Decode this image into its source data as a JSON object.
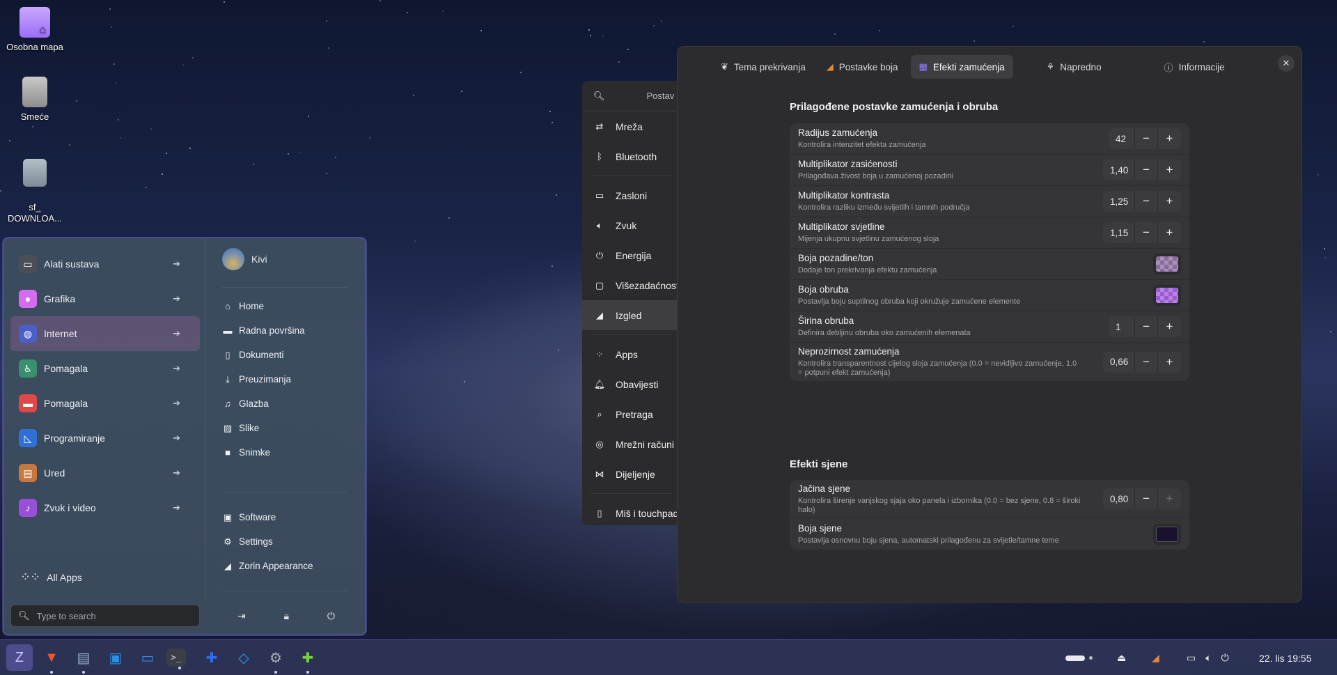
{
  "desktop": {
    "icons": [
      {
        "label": "Osobna mapa"
      },
      {
        "label": "Smeće"
      },
      {
        "label": "sf_\nDOWNLOA..."
      }
    ]
  },
  "start_menu": {
    "categories": [
      {
        "label": "Alati sustava",
        "icon": "monitor-icon",
        "color": "#4a4f57"
      },
      {
        "label": "Grafika",
        "icon": "palette-icon",
        "color": "#d46cf0"
      },
      {
        "label": "Internet",
        "icon": "globe-icon",
        "color": "#4b5fc8"
      },
      {
        "label": "Pomagala",
        "icon": "accessibility-icon",
        "color": "#3a8f6e"
      },
      {
        "label": "Pomagala",
        "icon": "toolbox-icon",
        "color": "#e04848"
      },
      {
        "label": "Programiranje",
        "icon": "ruler-icon",
        "color": "#2f6fd6"
      },
      {
        "label": "Ured",
        "icon": "briefcase-icon",
        "color": "#c9783c"
      },
      {
        "label": "Zvuk i video",
        "icon": "music-icon",
        "color": "#9a4fd8"
      }
    ],
    "all_apps": "All Apps",
    "search_placeholder": "Type to search",
    "user": "Kivi",
    "places": [
      {
        "label": "Home",
        "icon": "home-icon"
      },
      {
        "label": "Radna površina",
        "icon": "desktop-icon"
      },
      {
        "label": "Dokumenti",
        "icon": "document-icon"
      },
      {
        "label": "Preuzimanja",
        "icon": "download-icon"
      },
      {
        "label": "Glazba",
        "icon": "music-note-icon"
      },
      {
        "label": "Slike",
        "icon": "image-icon"
      },
      {
        "label": "Snimke",
        "icon": "video-icon"
      }
    ],
    "system": [
      {
        "label": "Software",
        "icon": "bag-icon"
      },
      {
        "label": "Settings",
        "icon": "gear-icon"
      },
      {
        "label": "Zorin Appearance",
        "icon": "appearance-icon"
      }
    ]
  },
  "settings_window": {
    "search_title": "Postav",
    "items": [
      {
        "label": "Mreža",
        "icon": "network-icon"
      },
      {
        "label": "Bluetooth",
        "icon": "bluetooth-icon"
      },
      {
        "label": "Zasloni",
        "icon": "display-icon"
      },
      {
        "label": "Zvuk",
        "icon": "speaker-icon"
      },
      {
        "label": "Energija",
        "icon": "power-icon"
      },
      {
        "label": "Višezadaćnost",
        "icon": "multitask-icon"
      },
      {
        "label": "Izgled",
        "icon": "appearance-icon"
      },
      {
        "label": "Apps",
        "icon": "apps-icon"
      },
      {
        "label": "Obavijesti",
        "icon": "bell-icon"
      },
      {
        "label": "Pretraga",
        "icon": "search-icon"
      },
      {
        "label": "Mrežni računi",
        "icon": "accounts-icon"
      },
      {
        "label": "Dijeljenje",
        "icon": "share-icon"
      },
      {
        "label": "Miš i touchpad",
        "icon": "mouse-icon"
      }
    ]
  },
  "dialog": {
    "tabs": [
      {
        "label": "Tema prekrivanja",
        "icon": "theme-icon"
      },
      {
        "label": "Postavke boja",
        "icon": "color-settings-icon"
      },
      {
        "label": "Efekti zamućenja",
        "icon": "blur-icon"
      },
      {
        "label": "Napredno",
        "icon": "advanced-icon"
      },
      {
        "label": "Informacije",
        "icon": "info-icon"
      }
    ],
    "section1_title": "Prilagođene postavke zamućenja i obruba",
    "section1": [
      {
        "title": "Radijus zamućenja",
        "subtitle": "Kontrolira intenzitet efekta zamućenja",
        "type": "spin",
        "value": "42"
      },
      {
        "title": "Multiplikator zasićenosti",
        "subtitle": "Prilagođava živost boja u zamućenoj pozadini",
        "type": "spin",
        "value": "1,40"
      },
      {
        "title": "Multiplikator kontrasta",
        "subtitle": "Kontrolira razliku između svijetlih i tamnih područja",
        "type": "spin",
        "value": "1,25"
      },
      {
        "title": "Multiplikator svjetline",
        "subtitle": "Mijenja ukupnu svjetlinu zamućenog sloja",
        "type": "spin",
        "value": "1,15"
      },
      {
        "title": "Boja pozadine/ton",
        "subtitle": "Dodaje ton prekrivanja efektu zamućenja",
        "type": "color",
        "color": "#8a6a9e"
      },
      {
        "title": "Boja obruba",
        "subtitle": "Postavlja boju suptilnog obruba koji okružuje zamućene elemente",
        "type": "color",
        "color": "#9c5ad6"
      },
      {
        "title": "Širina obruba",
        "subtitle": "Definira debljinu obruba oko zamućenih elemenata",
        "type": "spin",
        "value": "1"
      },
      {
        "title": "Neprozirnost zamućenja",
        "subtitle": "Kontrolira transparentnost cijelog sloja zamućenja (0.0 = nevidljivo zamućenje, 1.0 = potpuni efekt zamućenja)",
        "type": "spin",
        "value": "0,66"
      }
    ],
    "section2_title": "Efekti sjene",
    "section2": [
      {
        "title": "Jačina sjene",
        "subtitle": "Kontrolira širenje vanjskog sjaja oko panela i izbornika (0.0 = bez sjene, 0.8 = široki halo)",
        "type": "spin",
        "value": "0,80",
        "plus_disabled": true
      },
      {
        "title": "Boja sjene",
        "subtitle": "Postavlja osnovnu boju sjena, automatski prilagođenu za svijetle/tamne teme",
        "type": "color",
        "color": "#1a1030"
      }
    ],
    "minus": "−",
    "plus": "+"
  },
  "taskbar": {
    "clock": "22. lis  19:55",
    "apps": [
      {
        "name": "zorin-menu-icon",
        "glyph": "Z",
        "color": "#c9c6ff"
      },
      {
        "name": "brave-icon",
        "glyph": "▼",
        "color": "#f0532d"
      },
      {
        "name": "files-icon",
        "glyph": "▤",
        "color": "#9ab0c9"
      },
      {
        "name": "store-icon",
        "glyph": "▣",
        "color": "#2a8fe0"
      },
      {
        "name": "messages-icon",
        "glyph": "▭",
        "color": "#3b86e0"
      },
      {
        "name": "terminal-icon",
        "glyph": ">_",
        "color": "#cfd3da"
      },
      {
        "name": "extensions-icon",
        "glyph": "✚",
        "color": "#2d6ff0"
      },
      {
        "name": "vscode-icon",
        "glyph": "◇",
        "color": "#2a9df4"
      },
      {
        "name": "settings-icon",
        "glyph": "⚙",
        "color": "#a9b0bb"
      },
      {
        "name": "puzzle-icon",
        "glyph": "✚",
        "color": "#7bd13a"
      }
    ]
  }
}
